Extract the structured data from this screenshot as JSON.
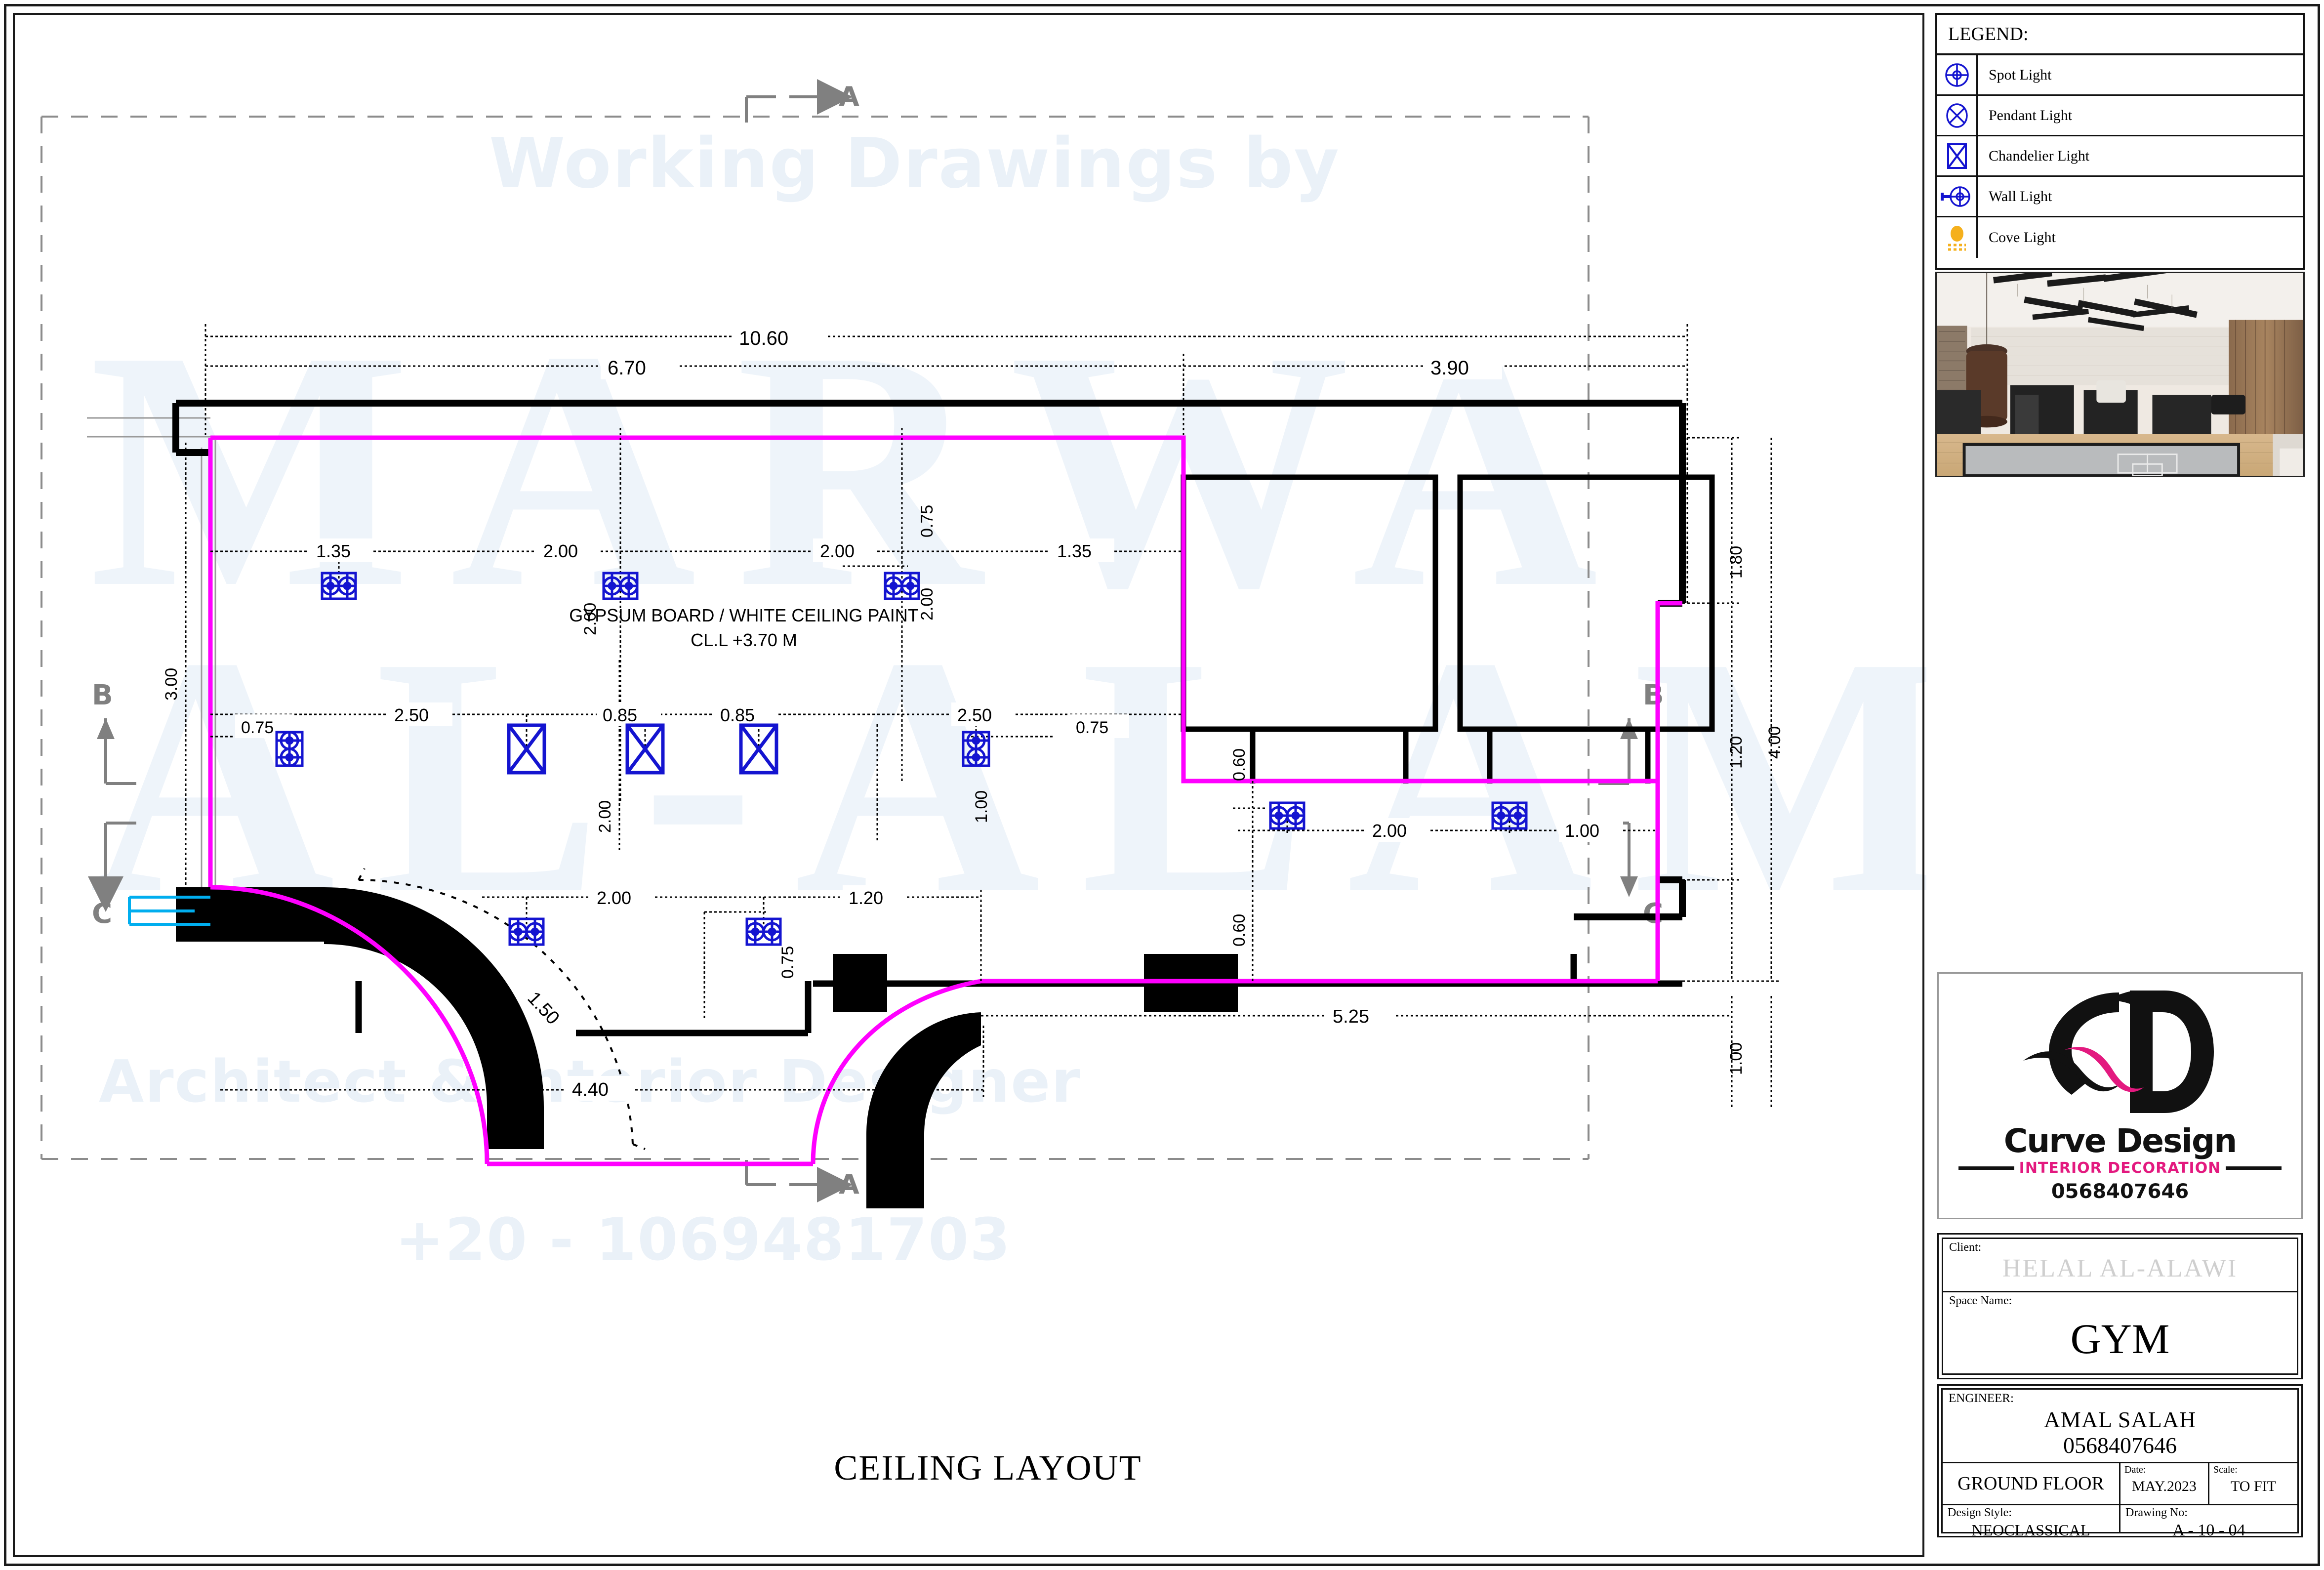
{
  "sheet": {
    "drawing_title": "CEILING LAYOUT"
  },
  "watermark": {
    "line1": "Working Drawings by",
    "line2": "Architect & Interior Designer",
    "line3": "+20 - 1069481703",
    "big1": "MARWA",
    "big2": "AL-ALAM"
  },
  "legend": {
    "title": "LEGEND:",
    "items": [
      {
        "icon": "spot-light-icon",
        "label": "Spot Light"
      },
      {
        "icon": "pendant-light-icon",
        "label": "Pendant Light"
      },
      {
        "icon": "chandelier-light-icon",
        "label": "Chandelier Light"
      },
      {
        "icon": "wall-light-icon",
        "label": "Wall Light"
      },
      {
        "icon": "cove-light-icon",
        "label": "Cove Light"
      }
    ]
  },
  "logo": {
    "monogram": "CD",
    "name": "Curve Design",
    "subtitle": "INTERIOR DECORATION",
    "phone": "0568407646"
  },
  "titleblock": {
    "client_label": "Client:",
    "client_value": "HELAL AL-ALAWI",
    "space_label": "Space Name:",
    "space_value": "GYM",
    "engineer_label": "ENGINEER:",
    "engineer_name": "AMAL SALAH",
    "engineer_phone": "0568407646",
    "floor": "GROUND FLOOR",
    "date_label": "Date:",
    "date_value": "MAY.2023",
    "scale_label": "Scale:",
    "scale_value": "TO FIT",
    "style_label": "Design Style:",
    "style_value": "NEOCLASSICAL",
    "drawing_no_label": "Drawing No:",
    "drawing_no_value": "A - 10 - 04"
  },
  "plan": {
    "ceiling_note_line1": "GYPSUM BOARD /  WHITE CEILING PAINT",
    "ceiling_note_line2": "CL.L +3.70 M",
    "section_markers": {
      "a_top": "A",
      "a_bottom": "A",
      "b_left": "B",
      "b_right": "B",
      "c_left": "C",
      "c_right": "C"
    },
    "dimensions": {
      "overall_top": "10.60",
      "top_left_span": "6.70",
      "top_right_span": "3.90",
      "spot_row": [
        "1.35",
        "2.00",
        "2.00",
        "1.35"
      ],
      "spot_row_vertical": [
        "0.75",
        "2.00",
        "2.00"
      ],
      "pendant_row": [
        "0.75",
        "2.50",
        "0.85",
        "0.85",
        "2.50",
        "0.75"
      ],
      "pendant_row_vertical": [
        "3.00",
        "2.00",
        "1.00"
      ],
      "lower_row": [
        "2.00",
        "1.20"
      ],
      "lower_row_vertical": [
        "0.75"
      ],
      "right_room_horizontal": [
        "2.00",
        "1.00"
      ],
      "right_room_vertical": [
        "0.60",
        "0.60"
      ],
      "right_side": [
        "1.80",
        "4.00",
        "1.20",
        "1.00"
      ],
      "bottom_left": "4.40",
      "bottom_right": "5.25",
      "door_radius": "1.50"
    },
    "colors": {
      "ceiling_outline": "#ff00ff",
      "fixture": "#1414d0",
      "wall": "#000000",
      "dim_line": "#000000",
      "grid_line": "#808080",
      "window": "#00aeef",
      "cove": "#f5a81c"
    }
  }
}
